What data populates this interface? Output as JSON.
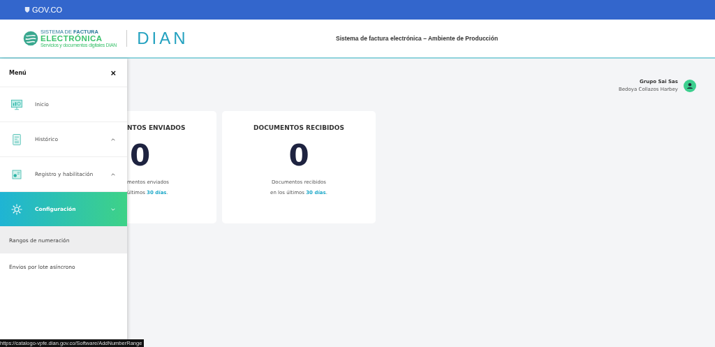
{
  "gov_bar": {
    "label": "GOV.CO"
  },
  "header": {
    "logo": {
      "line1": "SISTEMA DE ",
      "line1_bold": "FACTURA",
      "line2": "ELECTRÓNICA",
      "line3": "Servicios y documentos digitales DIAN"
    },
    "brand": "DIAN",
    "title": "Sistema de factura electrónica – Ambiente de Producción"
  },
  "menu": {
    "title": "Menú",
    "close": "×",
    "items": [
      {
        "label": "Inicio",
        "kind": "link",
        "selected": false
      },
      {
        "label": "Histórico",
        "kind": "group",
        "selected": false,
        "expanded": false
      },
      {
        "label": "Registro y habilitación",
        "kind": "group",
        "selected": false,
        "expanded": false
      },
      {
        "label": "Configuración",
        "kind": "group",
        "selected": true,
        "expanded": true,
        "children": [
          {
            "label": "Rangos de numeración",
            "selected": true
          },
          {
            "label": "Envios por lote asíncrono",
            "selected": false
          }
        ]
      }
    ]
  },
  "user": {
    "company": "Grupo Sai Sas",
    "name": "Bedoya Collazos Harbey"
  },
  "cards": [
    {
      "title": "NTOS ENVIADOS",
      "count": "0",
      "line1": "mentos enviados",
      "line2": "últimos **30 días**."
    },
    {
      "title": "DOCUMENTOS RECIBIDOS",
      "count": "0",
      "line1": "Documentos recibidos",
      "line2": "en los últimos **30 días**."
    }
  ],
  "status_bar": {
    "url": "https://catalogo-vpfe.dian.gov.co/Software/AddNumberRange"
  }
}
